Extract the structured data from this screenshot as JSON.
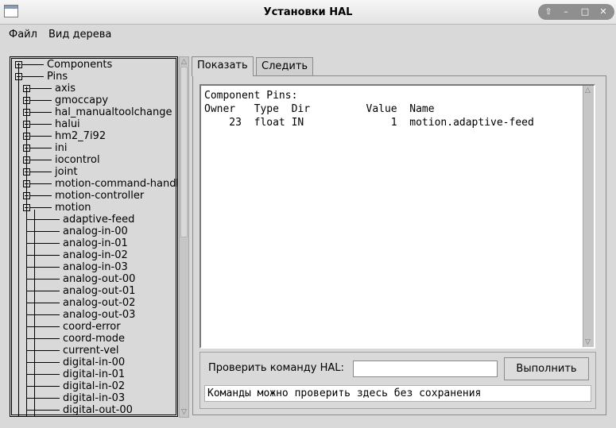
{
  "window": {
    "title": "Установки HAL",
    "controls": [
      "up-arrow-icon",
      "minimize-icon",
      "maximize-icon",
      "close-icon"
    ]
  },
  "menu": {
    "file": "Файл",
    "view_tree": "Вид дерева"
  },
  "tree": {
    "items": [
      {
        "label": "Components",
        "level": 0,
        "expander": "plus"
      },
      {
        "label": "Pins",
        "level": 0,
        "expander": "minus"
      },
      {
        "label": "axis",
        "level": 1,
        "expander": "plus"
      },
      {
        "label": "gmoccapy",
        "level": 1,
        "expander": "plus"
      },
      {
        "label": "hal_manualtoolchange",
        "level": 1,
        "expander": "plus"
      },
      {
        "label": "halui",
        "level": 1,
        "expander": "plus"
      },
      {
        "label": "hm2_7i92",
        "level": 1,
        "expander": "plus"
      },
      {
        "label": "ini",
        "level": 1,
        "expander": "plus"
      },
      {
        "label": "iocontrol",
        "level": 1,
        "expander": "plus"
      },
      {
        "label": "joint",
        "level": 1,
        "expander": "plus"
      },
      {
        "label": "motion-command-handler",
        "level": 1,
        "expander": "plus"
      },
      {
        "label": "motion-controller",
        "level": 1,
        "expander": "plus"
      },
      {
        "label": "motion",
        "level": 1,
        "expander": "minus"
      },
      {
        "label": "adaptive-feed",
        "level": 2,
        "expander": "none"
      },
      {
        "label": "analog-in-00",
        "level": 2,
        "expander": "none"
      },
      {
        "label": "analog-in-01",
        "level": 2,
        "expander": "none"
      },
      {
        "label": "analog-in-02",
        "level": 2,
        "expander": "none"
      },
      {
        "label": "analog-in-03",
        "level": 2,
        "expander": "none"
      },
      {
        "label": "analog-out-00",
        "level": 2,
        "expander": "none"
      },
      {
        "label": "analog-out-01",
        "level": 2,
        "expander": "none"
      },
      {
        "label": "analog-out-02",
        "level": 2,
        "expander": "none"
      },
      {
        "label": "analog-out-03",
        "level": 2,
        "expander": "none"
      },
      {
        "label": "coord-error",
        "level": 2,
        "expander": "none"
      },
      {
        "label": "coord-mode",
        "level": 2,
        "expander": "none"
      },
      {
        "label": "current-vel",
        "level": 2,
        "expander": "none"
      },
      {
        "label": "digital-in-00",
        "level": 2,
        "expander": "none"
      },
      {
        "label": "digital-in-01",
        "level": 2,
        "expander": "none"
      },
      {
        "label": "digital-in-02",
        "level": 2,
        "expander": "none"
      },
      {
        "label": "digital-in-03",
        "level": 2,
        "expander": "none"
      },
      {
        "label": "digital-out-00",
        "level": 2,
        "expander": "none"
      }
    ]
  },
  "tree_scroll": {
    "position_fraction": 0.0,
    "visible_fraction": 0.5
  },
  "tabs": [
    {
      "label": "Показать",
      "active": true
    },
    {
      "label": "Следить",
      "active": false
    }
  ],
  "output": {
    "heading": "Component Pins:",
    "columns": [
      "Owner",
      "Type",
      "Dir",
      "Value",
      "Name"
    ],
    "rows": [
      {
        "owner": "23",
        "type": "float",
        "dir": "IN",
        "value": "1",
        "name": "motion.adaptive-feed"
      }
    ]
  },
  "command": {
    "label": "Проверить команду HAL:",
    "input_value": "",
    "button": "Выполнить",
    "status": "Команды можно проверить здесь без сохранения"
  },
  "colors": {
    "background": "#d9d9d9",
    "text": "#000000",
    "field": "#ffffff"
  }
}
